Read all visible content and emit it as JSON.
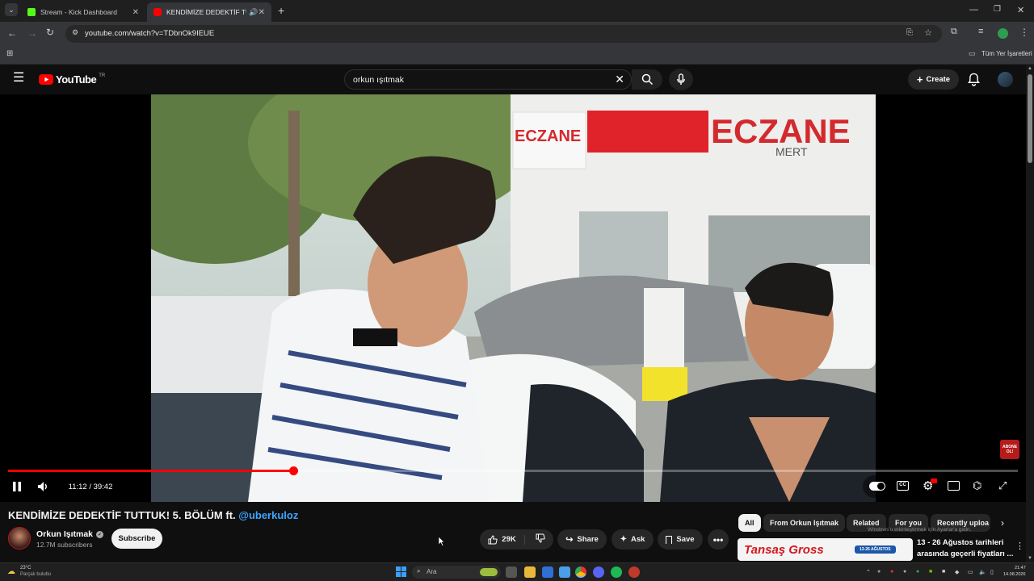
{
  "browser": {
    "tabs": [
      {
        "title": "Stream - Kick Dashboard",
        "favicon_color": "#53fc18"
      },
      {
        "title": "KENDİMİZE DEDEKTİF TUTTU",
        "favicon_color": "#ff0000"
      }
    ],
    "url": "youtube.com/watch?v=TDbnOk9IEUE",
    "bookmarks_label": "Tüm Yer İşaretleri"
  },
  "youtube": {
    "logo_text": "YouTube",
    "region": "TR",
    "search_value": "orkun ışıtmak",
    "create_label": "Create"
  },
  "player": {
    "time_current": "11:12",
    "time_total": "39:42",
    "time_display": "11:12 / 39:42",
    "progress": 0.282,
    "watermark": "ABONE OL!"
  },
  "video": {
    "title_main": "KENDİMİZE DEDEKTİF TUTTUK! 5. BÖLÜM ft. ",
    "title_mention": "@uberkuloz",
    "channel_name": "Orkun Işıtmak",
    "subscribers": "12.7M subscribers",
    "subscribe_label": "Subscribe",
    "likes": "29K",
    "share_label": "Share",
    "ask_label": "Ask",
    "save_label": "Save"
  },
  "chips": [
    "All",
    "From Orkun Işıtmak",
    "Related",
    "For you",
    "Recently uploa"
  ],
  "windows_watermark": "Windows'u etkinleştirmek için Ayarlar'a gidin.",
  "ad": {
    "brand": "Tansaş Gross",
    "badge": "13-26 AĞUSTOS",
    "text_line1": "13 - 26 Ağustos tarihleri",
    "text_line2": "arasında geçerli fiyatları ..."
  },
  "taskbar": {
    "weather_temp": "23°C",
    "weather_desc": "Parçalı bulutlu",
    "search_label": "Ara",
    "time": "21:47",
    "date": "14.08.2026"
  },
  "colors": {
    "yt_red": "#ff0000",
    "link_blue": "#3ea6ff",
    "bg": "#0f0f0f"
  }
}
